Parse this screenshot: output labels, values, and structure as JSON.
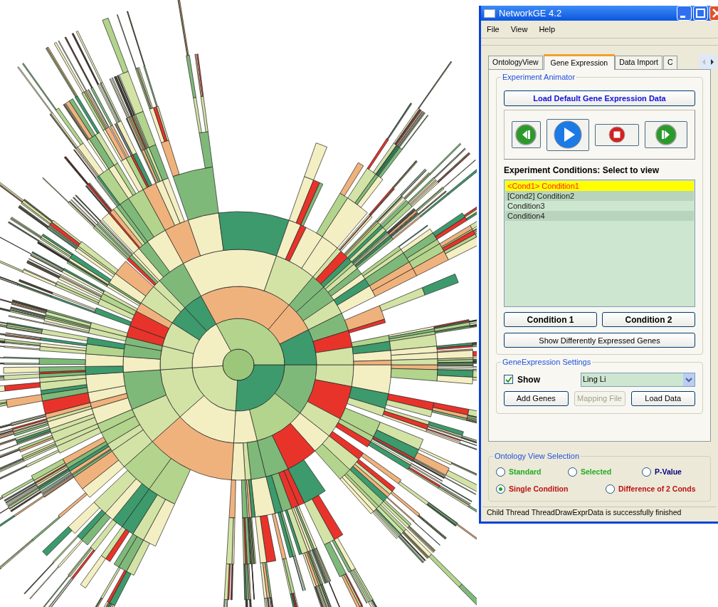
{
  "window": {
    "title": "NetworkGE 4.2"
  },
  "menu": [
    "File",
    "View",
    "Help"
  ],
  "tabs": [
    {
      "label": "OntologyView",
      "selected": false
    },
    {
      "label": "Gene Expression",
      "selected": true
    },
    {
      "label": "Data Import",
      "selected": false
    },
    {
      "label": "C",
      "selected": false
    }
  ],
  "experiment_animator": {
    "title": "Experiment Animator",
    "load_button": "Load Default  Gene Expression Data",
    "conditions_label": "Experiment Conditions: Select to view",
    "conditions": [
      {
        "label": "<Cond1> Condition1",
        "selected": true
      },
      {
        "label": "[Cond2] Condition2",
        "selected": false
      },
      {
        "label": "Condition3",
        "selected": false
      },
      {
        "label": "Condition4",
        "selected": false
      }
    ],
    "condition_buttons": [
      "Condition 1",
      "Condition 2"
    ],
    "diff_button": "Show Differently Expressed Genes"
  },
  "settings": {
    "title": "GeneExpression Settings",
    "show": {
      "label": "Show",
      "checked": true
    },
    "dropdown_value": "Ling Li",
    "buttons": [
      {
        "label": "Add Genes",
        "disabled": false
      },
      {
        "label": "Mapping File",
        "disabled": true
      },
      {
        "label": "Load Data",
        "disabled": false
      }
    ]
  },
  "ontology_view_selection": {
    "title": "Ontology View Selection",
    "options": [
      {
        "label": "Standard",
        "selected": false,
        "color": "#22aa22"
      },
      {
        "label": "Selected",
        "selected": false,
        "color": "#22aa22"
      },
      {
        "label": "P-Value",
        "selected": false,
        "color": "#000080"
      },
      {
        "label": "Single Condition",
        "selected": true,
        "color": "#bb1111"
      },
      {
        "label": "Difference of 2 Conds",
        "selected": false,
        "color": "#bb1111"
      }
    ]
  },
  "status_bar": "Child Thread ThreadDrawExprData is successfully finished"
}
